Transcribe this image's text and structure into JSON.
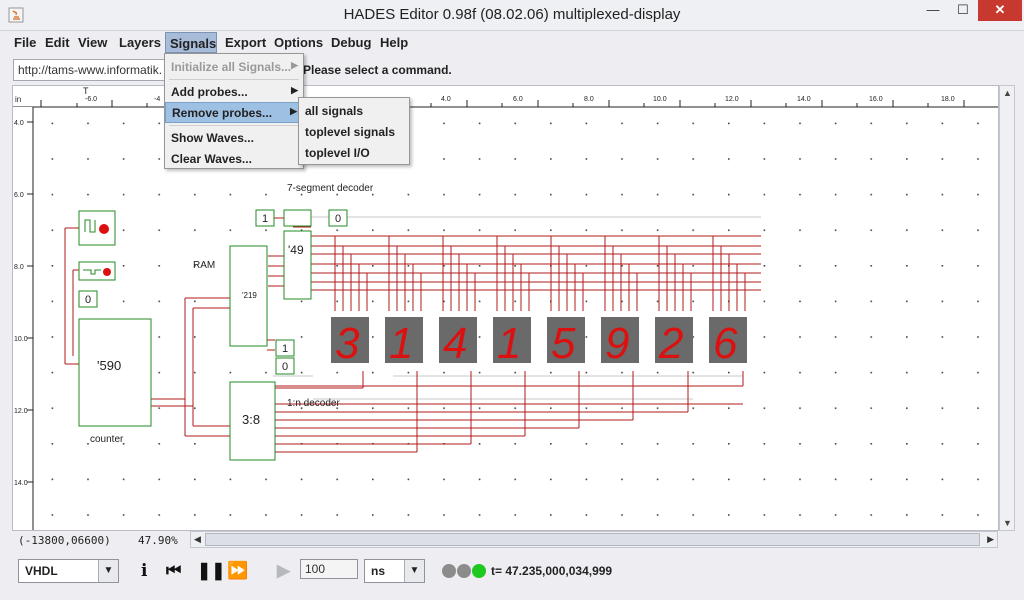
{
  "window": {
    "title": "HADES Editor 0.98f (08.02.06)   multiplexed-display",
    "minimize_glyph": "—",
    "maximize_glyph": "☐",
    "close_glyph": "✕"
  },
  "menubar": {
    "items": [
      "File",
      "Edit",
      "View",
      "Layers",
      "Signals",
      "Export",
      "Options",
      "Debug",
      "Help"
    ],
    "active": "Signals"
  },
  "signals_menu": {
    "items": [
      {
        "label": "Initialize all Signals...",
        "enabled": false,
        "submenu": true
      },
      {
        "label": "Add probes...",
        "enabled": true,
        "submenu": true
      },
      {
        "label": "Remove probes...",
        "enabled": true,
        "submenu": true,
        "highlighted": true
      },
      {
        "label": "Show Waves...",
        "enabled": true,
        "submenu": false
      },
      {
        "label": "Clear Waves...",
        "enabled": true,
        "submenu": false
      }
    ]
  },
  "remove_probes_submenu": {
    "items": [
      "all signals",
      "toplevel signals",
      "toplevel I/O"
    ]
  },
  "toolbar": {
    "url": "http://tams-www.informatik.",
    "status": "Please select a command."
  },
  "ruler": {
    "unit": "in",
    "x_ticks": [
      "-6.0",
      "-4",
      "4.0",
      "6.0",
      "8.0",
      "10.0",
      "12.0",
      "14.0",
      "16.0",
      "18.0"
    ],
    "y_ticks": [
      "4.0",
      "6.0",
      "8.0",
      "10.0",
      "12.0",
      "14.0"
    ],
    "cursor_marker": "T"
  },
  "schematic": {
    "labels": {
      "decoder7": "7-segment decoder",
      "ram": "RAM",
      "counter": "counter",
      "decoder_1n": "1:n decoder",
      "chip_590": "'590",
      "chip_49": "'49",
      "chip_219": "'219",
      "chip_38": "3:8"
    },
    "const_values": [
      "1",
      "0",
      "0",
      "1",
      "0"
    ],
    "display_digits": [
      "3",
      "1",
      "4",
      "1",
      "5",
      "9",
      "2",
      "6"
    ],
    "wire_color": "#b01818",
    "component_color": "#228a22",
    "digit_color": "#dd1010"
  },
  "statusbar": {
    "coords": "(-13800,06600)",
    "zoom": "47.90%"
  },
  "controls": {
    "language": "VHDL",
    "time_step": "100",
    "time_unit": "ns",
    "sim_time": "t= 47.235,000,034,999",
    "led_colors": [
      "#8c8c8c",
      "#8c8c8c",
      "#1ec81e"
    ],
    "icons": [
      "info-icon",
      "rewind-icon",
      "pause-icon",
      "fast-forward-icon",
      "play-icon"
    ]
  }
}
